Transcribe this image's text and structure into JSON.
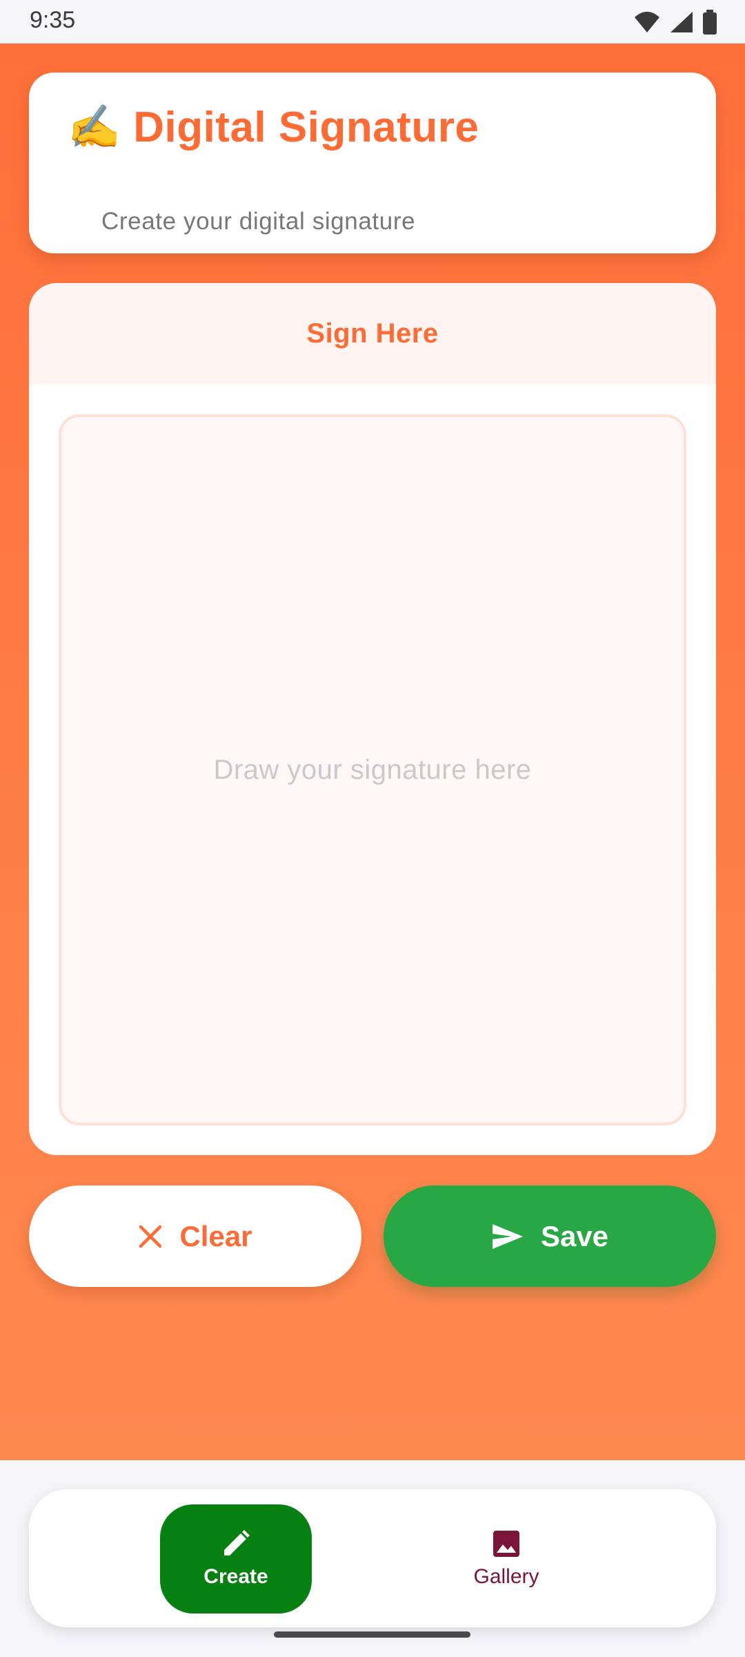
{
  "status_bar": {
    "time": "9:35",
    "icons": [
      "wifi-icon",
      "signal-icon",
      "battery-icon"
    ]
  },
  "header": {
    "emoji": "✍️",
    "title": "Digital Signature",
    "subtitle": "Create your digital signature"
  },
  "canvas": {
    "title": "Sign Here",
    "placeholder": "Draw your signature here"
  },
  "actions": {
    "clear_label": "Clear",
    "clear_icon": "close-icon",
    "save_label": "Save",
    "save_icon": "send-icon"
  },
  "bottom_nav": {
    "items": [
      {
        "label": "Create",
        "icon": "pencil-icon",
        "active": true
      },
      {
        "label": "Gallery",
        "icon": "image-icon",
        "active": false
      }
    ]
  },
  "colors": {
    "accent": "#ff6b35",
    "save_green": "#28a745",
    "nav_active": "#078012",
    "gallery_text": "#7a1438"
  }
}
